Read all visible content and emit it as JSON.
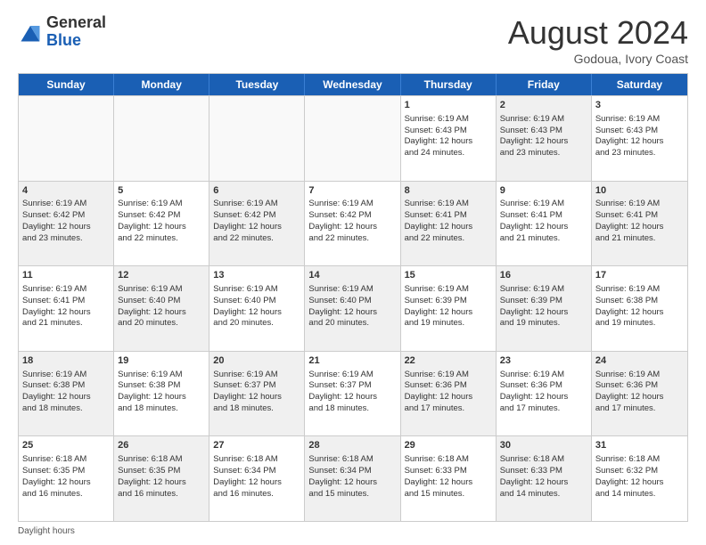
{
  "header": {
    "logo_general": "General",
    "logo_blue": "Blue",
    "month_title": "August 2024",
    "subtitle": "Godoua, Ivory Coast"
  },
  "weekdays": [
    "Sunday",
    "Monday",
    "Tuesday",
    "Wednesday",
    "Thursday",
    "Friday",
    "Saturday"
  ],
  "footer": "Daylight hours",
  "weeks": [
    [
      {
        "day": "",
        "info": "",
        "shaded": false,
        "empty": true
      },
      {
        "day": "",
        "info": "",
        "shaded": false,
        "empty": true
      },
      {
        "day": "",
        "info": "",
        "shaded": false,
        "empty": true
      },
      {
        "day": "",
        "info": "",
        "shaded": false,
        "empty": true
      },
      {
        "day": "1",
        "info": "Sunrise: 6:19 AM\nSunset: 6:43 PM\nDaylight: 12 hours\nand 24 minutes.",
        "shaded": false,
        "empty": false
      },
      {
        "day": "2",
        "info": "Sunrise: 6:19 AM\nSunset: 6:43 PM\nDaylight: 12 hours\nand 23 minutes.",
        "shaded": true,
        "empty": false
      },
      {
        "day": "3",
        "info": "Sunrise: 6:19 AM\nSunset: 6:43 PM\nDaylight: 12 hours\nand 23 minutes.",
        "shaded": false,
        "empty": false
      }
    ],
    [
      {
        "day": "4",
        "info": "Sunrise: 6:19 AM\nSunset: 6:42 PM\nDaylight: 12 hours\nand 23 minutes.",
        "shaded": true,
        "empty": false
      },
      {
        "day": "5",
        "info": "Sunrise: 6:19 AM\nSunset: 6:42 PM\nDaylight: 12 hours\nand 22 minutes.",
        "shaded": false,
        "empty": false
      },
      {
        "day": "6",
        "info": "Sunrise: 6:19 AM\nSunset: 6:42 PM\nDaylight: 12 hours\nand 22 minutes.",
        "shaded": true,
        "empty": false
      },
      {
        "day": "7",
        "info": "Sunrise: 6:19 AM\nSunset: 6:42 PM\nDaylight: 12 hours\nand 22 minutes.",
        "shaded": false,
        "empty": false
      },
      {
        "day": "8",
        "info": "Sunrise: 6:19 AM\nSunset: 6:41 PM\nDaylight: 12 hours\nand 22 minutes.",
        "shaded": true,
        "empty": false
      },
      {
        "day": "9",
        "info": "Sunrise: 6:19 AM\nSunset: 6:41 PM\nDaylight: 12 hours\nand 21 minutes.",
        "shaded": false,
        "empty": false
      },
      {
        "day": "10",
        "info": "Sunrise: 6:19 AM\nSunset: 6:41 PM\nDaylight: 12 hours\nand 21 minutes.",
        "shaded": true,
        "empty": false
      }
    ],
    [
      {
        "day": "11",
        "info": "Sunrise: 6:19 AM\nSunset: 6:41 PM\nDaylight: 12 hours\nand 21 minutes.",
        "shaded": false,
        "empty": false
      },
      {
        "day": "12",
        "info": "Sunrise: 6:19 AM\nSunset: 6:40 PM\nDaylight: 12 hours\nand 20 minutes.",
        "shaded": true,
        "empty": false
      },
      {
        "day": "13",
        "info": "Sunrise: 6:19 AM\nSunset: 6:40 PM\nDaylight: 12 hours\nand 20 minutes.",
        "shaded": false,
        "empty": false
      },
      {
        "day": "14",
        "info": "Sunrise: 6:19 AM\nSunset: 6:40 PM\nDaylight: 12 hours\nand 20 minutes.",
        "shaded": true,
        "empty": false
      },
      {
        "day": "15",
        "info": "Sunrise: 6:19 AM\nSunset: 6:39 PM\nDaylight: 12 hours\nand 19 minutes.",
        "shaded": false,
        "empty": false
      },
      {
        "day": "16",
        "info": "Sunrise: 6:19 AM\nSunset: 6:39 PM\nDaylight: 12 hours\nand 19 minutes.",
        "shaded": true,
        "empty": false
      },
      {
        "day": "17",
        "info": "Sunrise: 6:19 AM\nSunset: 6:38 PM\nDaylight: 12 hours\nand 19 minutes.",
        "shaded": false,
        "empty": false
      }
    ],
    [
      {
        "day": "18",
        "info": "Sunrise: 6:19 AM\nSunset: 6:38 PM\nDaylight: 12 hours\nand 18 minutes.",
        "shaded": true,
        "empty": false
      },
      {
        "day": "19",
        "info": "Sunrise: 6:19 AM\nSunset: 6:38 PM\nDaylight: 12 hours\nand 18 minutes.",
        "shaded": false,
        "empty": false
      },
      {
        "day": "20",
        "info": "Sunrise: 6:19 AM\nSunset: 6:37 PM\nDaylight: 12 hours\nand 18 minutes.",
        "shaded": true,
        "empty": false
      },
      {
        "day": "21",
        "info": "Sunrise: 6:19 AM\nSunset: 6:37 PM\nDaylight: 12 hours\nand 18 minutes.",
        "shaded": false,
        "empty": false
      },
      {
        "day": "22",
        "info": "Sunrise: 6:19 AM\nSunset: 6:36 PM\nDaylight: 12 hours\nand 17 minutes.",
        "shaded": true,
        "empty": false
      },
      {
        "day": "23",
        "info": "Sunrise: 6:19 AM\nSunset: 6:36 PM\nDaylight: 12 hours\nand 17 minutes.",
        "shaded": false,
        "empty": false
      },
      {
        "day": "24",
        "info": "Sunrise: 6:19 AM\nSunset: 6:36 PM\nDaylight: 12 hours\nand 17 minutes.",
        "shaded": true,
        "empty": false
      }
    ],
    [
      {
        "day": "25",
        "info": "Sunrise: 6:18 AM\nSunset: 6:35 PM\nDaylight: 12 hours\nand 16 minutes.",
        "shaded": false,
        "empty": false
      },
      {
        "day": "26",
        "info": "Sunrise: 6:18 AM\nSunset: 6:35 PM\nDaylight: 12 hours\nand 16 minutes.",
        "shaded": true,
        "empty": false
      },
      {
        "day": "27",
        "info": "Sunrise: 6:18 AM\nSunset: 6:34 PM\nDaylight: 12 hours\nand 16 minutes.",
        "shaded": false,
        "empty": false
      },
      {
        "day": "28",
        "info": "Sunrise: 6:18 AM\nSunset: 6:34 PM\nDaylight: 12 hours\nand 15 minutes.",
        "shaded": true,
        "empty": false
      },
      {
        "day": "29",
        "info": "Sunrise: 6:18 AM\nSunset: 6:33 PM\nDaylight: 12 hours\nand 15 minutes.",
        "shaded": false,
        "empty": false
      },
      {
        "day": "30",
        "info": "Sunrise: 6:18 AM\nSunset: 6:33 PM\nDaylight: 12 hours\nand 14 minutes.",
        "shaded": true,
        "empty": false
      },
      {
        "day": "31",
        "info": "Sunrise: 6:18 AM\nSunset: 6:32 PM\nDaylight: 12 hours\nand 14 minutes.",
        "shaded": false,
        "empty": false
      }
    ]
  ]
}
